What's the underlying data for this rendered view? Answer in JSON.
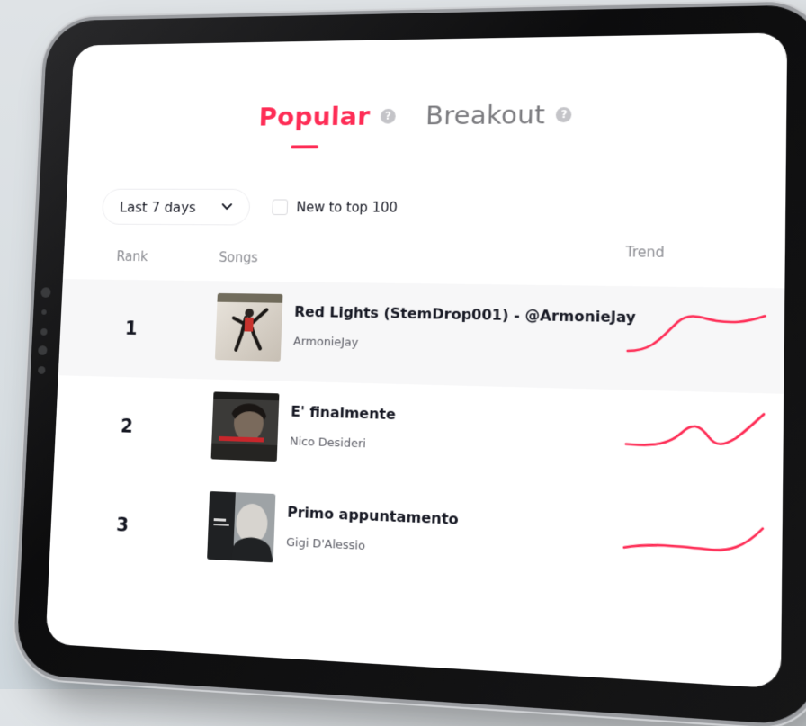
{
  "tabs": [
    {
      "label": "Popular",
      "active": true,
      "help": "?"
    },
    {
      "label": "Breakout",
      "active": false,
      "help": "?"
    }
  ],
  "filters": {
    "period": "Last 7 days",
    "new_to_top": "New to top 100"
  },
  "columns": {
    "rank": "Rank",
    "songs": "Songs",
    "trend": "Trend"
  },
  "songs": [
    {
      "rank": "1",
      "title": "Red Lights (StemDrop001) - @ArmonieJay",
      "artist": "ArmonieJay"
    },
    {
      "rank": "2",
      "title": "E' finalmente",
      "artist": "Nico Desideri"
    },
    {
      "rank": "3",
      "title": "Primo appuntamento",
      "artist": "Gigi D'Alessio"
    }
  ],
  "colors": {
    "accent": "#fe2c55"
  }
}
